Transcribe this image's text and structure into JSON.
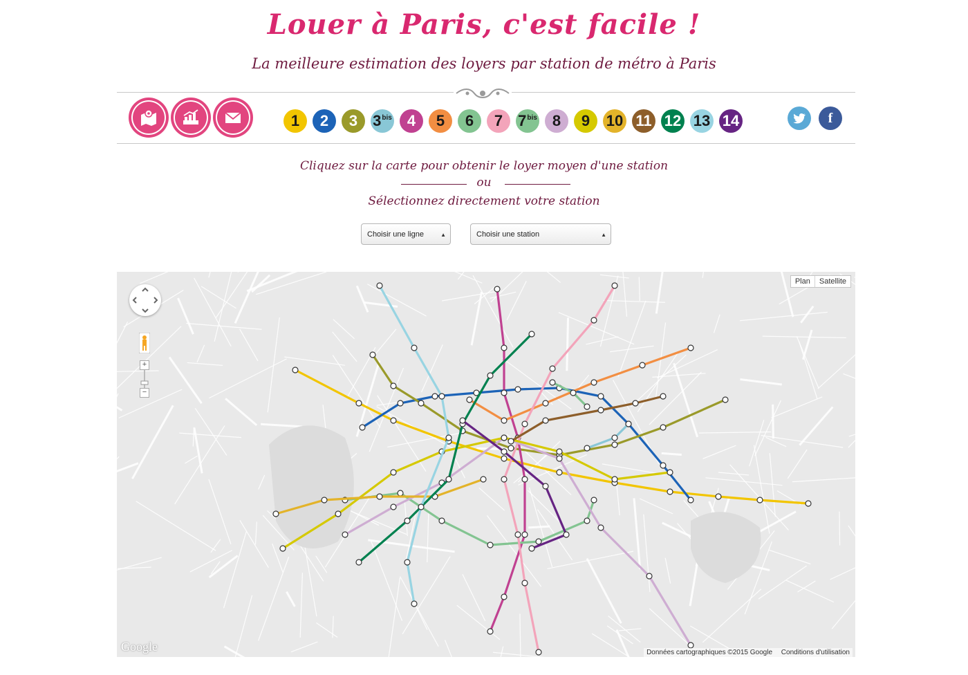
{
  "header": {
    "title": "Louer à Paris, c'est facile !",
    "subtitle": "La meilleure estimation des loyers par station de métro à Paris"
  },
  "nav_icons": [
    {
      "icon": "map-pin-icon"
    },
    {
      "icon": "chart-icon"
    },
    {
      "icon": "mail-icon"
    }
  ],
  "metro_lines": [
    {
      "label": "1",
      "sup": "",
      "color": "#f2c500",
      "text": "#1a1a1a"
    },
    {
      "label": "2",
      "sup": "",
      "color": "#1c63b7",
      "text": "#ffffff"
    },
    {
      "label": "3",
      "sup": "",
      "color": "#9a9a2a",
      "text": "#ffffff"
    },
    {
      "label": "3",
      "sup": "bis",
      "color": "#89c7d6",
      "text": "#1a1a1a"
    },
    {
      "label": "4",
      "sup": "",
      "color": "#c04191",
      "text": "#ffffff"
    },
    {
      "label": "5",
      "sup": "",
      "color": "#f28e42",
      "text": "#1a1a1a"
    },
    {
      "label": "6",
      "sup": "",
      "color": "#83c491",
      "text": "#1a1a1a"
    },
    {
      "label": "7",
      "sup": "",
      "color": "#f3a4ba",
      "text": "#1a1a1a"
    },
    {
      "label": "7",
      "sup": "bis",
      "color": "#83c491",
      "text": "#1a1a1a"
    },
    {
      "label": "8",
      "sup": "",
      "color": "#ceadd2",
      "text": "#1a1a1a"
    },
    {
      "label": "9",
      "sup": "",
      "color": "#d5c900",
      "text": "#1a1a1a"
    },
    {
      "label": "10",
      "sup": "",
      "color": "#e3b32a",
      "text": "#1a1a1a"
    },
    {
      "label": "11",
      "sup": "",
      "color": "#8d5e2a",
      "text": "#ffffff"
    },
    {
      "label": "12",
      "sup": "",
      "color": "#00814f",
      "text": "#ffffff"
    },
    {
      "label": "13",
      "sup": "",
      "color": "#98d4e2",
      "text": "#1a1a1a"
    },
    {
      "label": "14",
      "sup": "",
      "color": "#662483",
      "text": "#ffffff"
    }
  ],
  "social": [
    {
      "name": "twitter",
      "icon": "twitter-icon",
      "color": "#5aa9d6"
    },
    {
      "name": "facebook",
      "icon": "facebook-icon",
      "color": "#3b5a9a",
      "glyph": "f"
    }
  ],
  "instructions": {
    "line1": "Cliquez sur la carte pour obtenir le loyer moyen d'une station",
    "or": "ou",
    "line2": "Sélectionnez directement votre station"
  },
  "selects": {
    "line_select": "Choisir une ligne",
    "station_select": "Choisir une station"
  },
  "map": {
    "type_buttons": [
      "Plan",
      "Satellite"
    ],
    "zoom_in": "+",
    "zoom_out": "−",
    "logo": "Google",
    "attribution": "Données cartographiques ©2015 Google",
    "terms": "Conditions d'utilisation"
  }
}
